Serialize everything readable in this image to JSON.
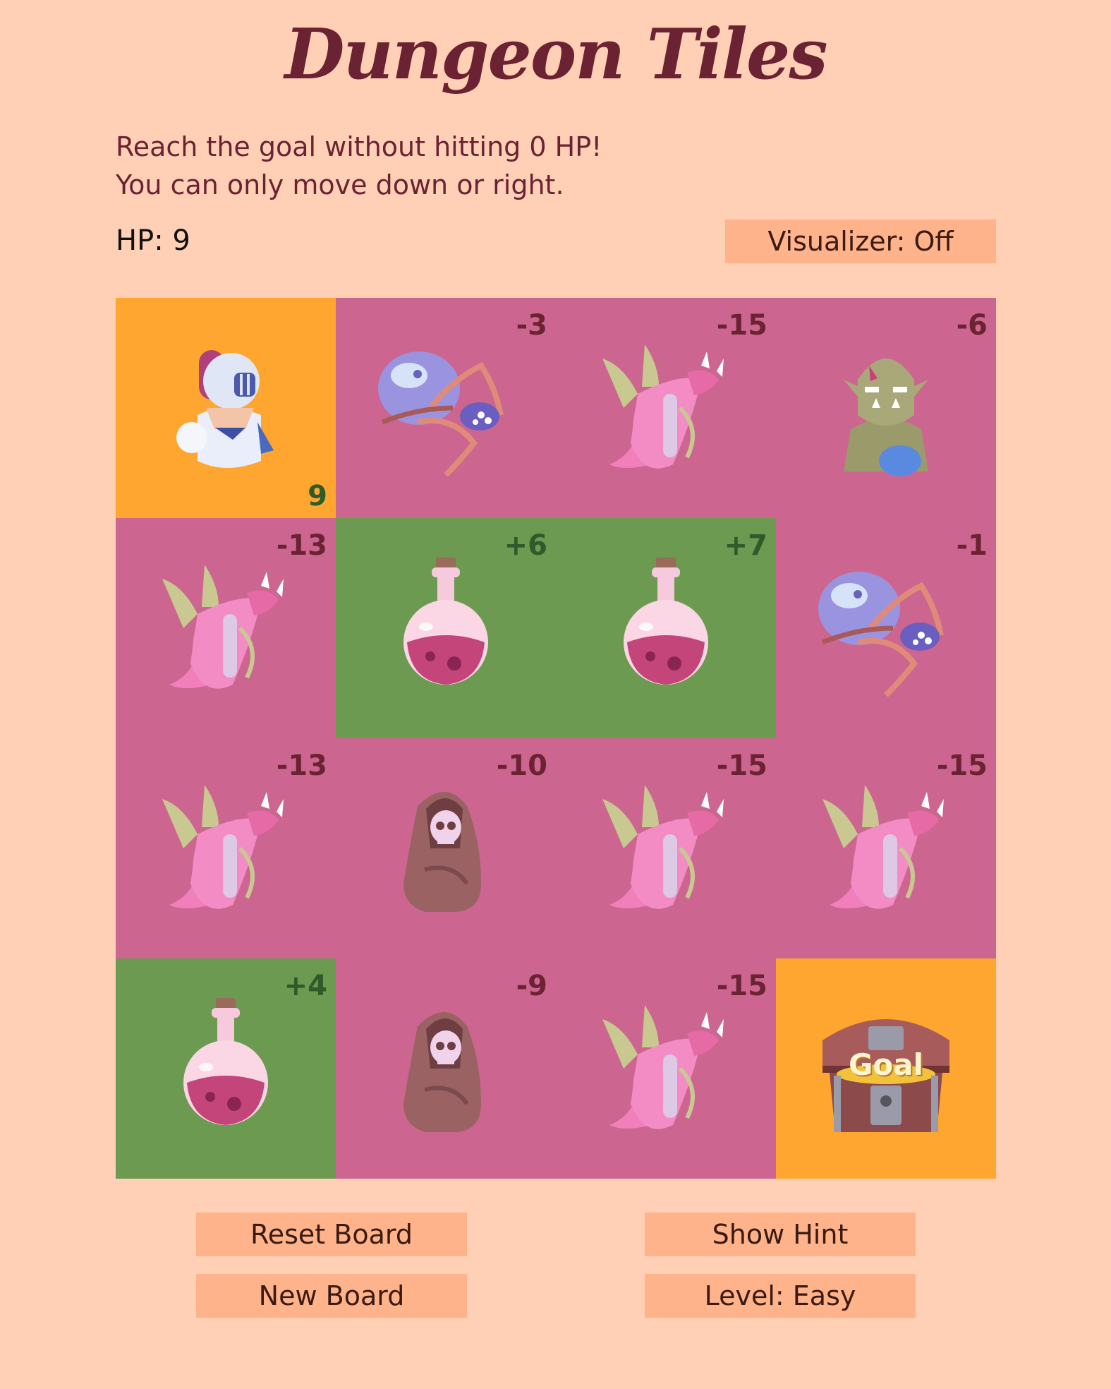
{
  "title": "Dungeon Tiles",
  "instructions": {
    "line1": "Reach the goal without hitting 0 HP!",
    "line2": "You can only move down or right."
  },
  "hp_label": "HP: 9",
  "buttons": {
    "visualizer": "Visualizer: Off",
    "reset": "Reset Board",
    "hint": "Show Hint",
    "new_board": "New Board",
    "level": "Level: Easy"
  },
  "colors": {
    "background": "#ffd0b5",
    "monster_tile": "#cc6690",
    "potion_tile": "#6b9a50",
    "special_tile": "#ffa630",
    "button": "#ffb38a"
  },
  "board": {
    "rows": [
      [
        {
          "kind": "start",
          "icon": "knight-icon",
          "value": "9"
        },
        {
          "kind": "monster",
          "icon": "spider-icon",
          "value": "-3"
        },
        {
          "kind": "monster",
          "icon": "dragon-icon",
          "value": "-15"
        },
        {
          "kind": "monster",
          "icon": "orc-icon",
          "value": "-6"
        }
      ],
      [
        {
          "kind": "monster",
          "icon": "dragon-icon",
          "value": "-13"
        },
        {
          "kind": "potion",
          "icon": "potion-icon",
          "value": "+6"
        },
        {
          "kind": "potion",
          "icon": "potion-icon",
          "value": "+7"
        },
        {
          "kind": "monster",
          "icon": "spider-icon",
          "value": "-1"
        }
      ],
      [
        {
          "kind": "monster",
          "icon": "dragon-icon",
          "value": "-13"
        },
        {
          "kind": "monster",
          "icon": "reaper-icon",
          "value": "-10"
        },
        {
          "kind": "monster",
          "icon": "dragon-icon",
          "value": "-15"
        },
        {
          "kind": "monster",
          "icon": "dragon-icon",
          "value": "-15"
        }
      ],
      [
        {
          "kind": "potion",
          "icon": "potion-icon",
          "value": "+4"
        },
        {
          "kind": "monster",
          "icon": "reaper-icon",
          "value": "-9"
        },
        {
          "kind": "monster",
          "icon": "dragon-icon",
          "value": "-15"
        },
        {
          "kind": "goal",
          "icon": "treasure-chest-icon",
          "value": "Goal"
        }
      ]
    ]
  }
}
